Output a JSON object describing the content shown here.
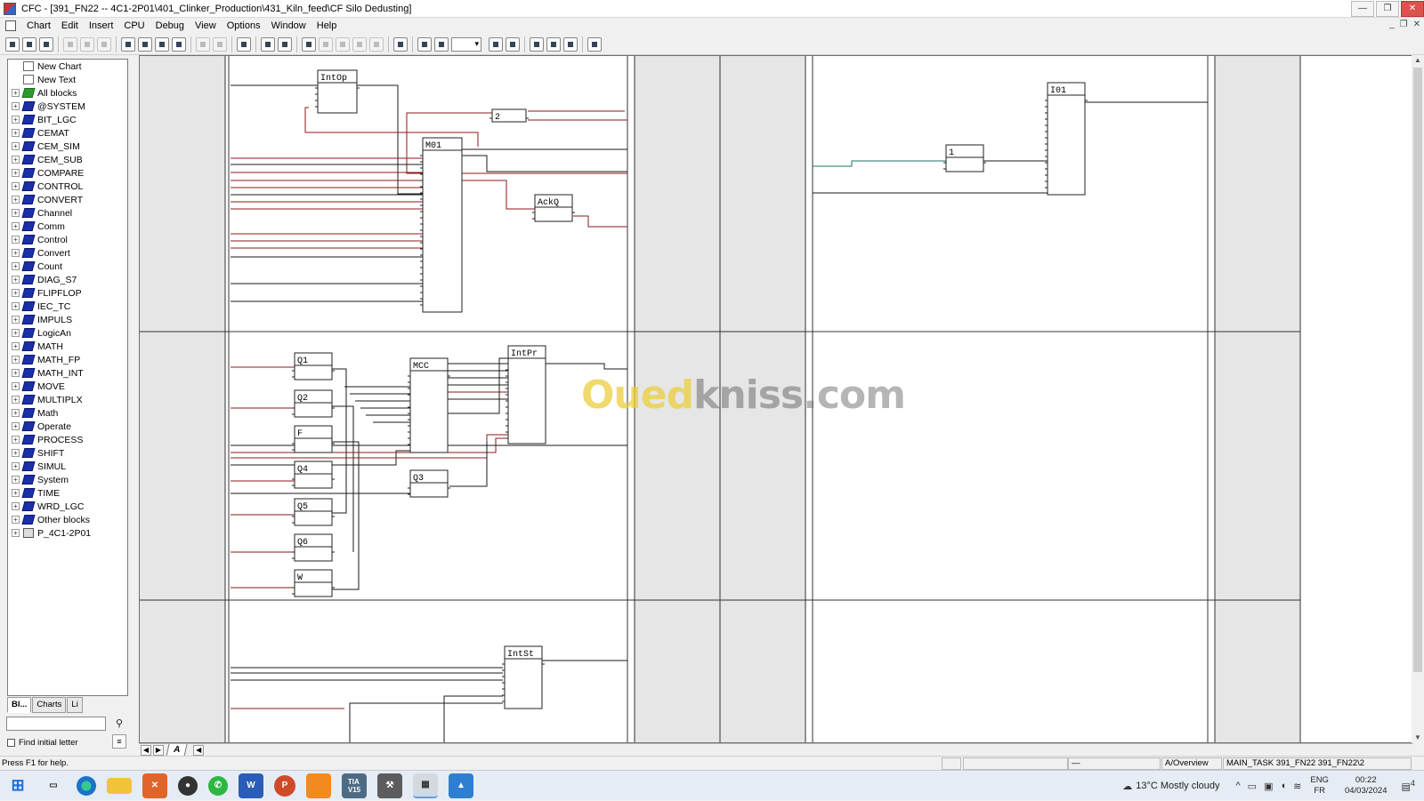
{
  "window": {
    "title": "CFC - [391_FN22 -- 4C1-2P01\\401_Clinker_Production\\431_Kiln_feed\\CF Silo Dedusting]",
    "controls": [
      "—",
      "❐",
      "✕"
    ]
  },
  "menu": [
    "Chart",
    "Edit",
    "Insert",
    "CPU",
    "Debug",
    "View",
    "Options",
    "Window",
    "Help"
  ],
  "mdi_controls": [
    "_",
    "❐",
    "✕"
  ],
  "toolbar_icons": [
    "new-icon",
    "open-icon",
    "print-icon",
    "cut-icon",
    "copy-icon",
    "paste-icon",
    "catalog-icon",
    "overview-icon",
    "tree-icon",
    "interconnect-icon",
    "run-seq-icon",
    "insert-icon",
    "compile-icon",
    "download-icon",
    "test-mode-icon",
    "watch-icon",
    "undo-icon",
    "delete-icon",
    "insert-run-icon",
    "predecessor-icon",
    "fit-icon",
    "grid-icon",
    "sheet-icon",
    "zoom-in-icon",
    "zoom-out-icon",
    "layers-icon",
    "split-h-icon",
    "split-v-icon",
    "help-icon"
  ],
  "tree": [
    {
      "label": "New Chart",
      "icon": "chart-icon",
      "expandable": false
    },
    {
      "label": "New Text",
      "icon": "text-icon",
      "expandable": false
    },
    {
      "label": "All blocks",
      "icon": "all-blocks-icon",
      "expandable": true
    },
    {
      "label": "@SYSTEM",
      "icon": "library-icon",
      "expandable": true
    },
    {
      "label": "BIT_LGC",
      "icon": "library-icon",
      "expandable": true
    },
    {
      "label": "CEMAT",
      "icon": "library-icon",
      "expandable": true
    },
    {
      "label": "CEM_SIM",
      "icon": "library-icon",
      "expandable": true
    },
    {
      "label": "CEM_SUB",
      "icon": "library-icon",
      "expandable": true
    },
    {
      "label": "COMPARE",
      "icon": "library-icon",
      "expandable": true
    },
    {
      "label": "CONTROL",
      "icon": "library-icon",
      "expandable": true
    },
    {
      "label": "CONVERT",
      "icon": "library-icon",
      "expandable": true
    },
    {
      "label": "Channel",
      "icon": "library-icon",
      "expandable": true
    },
    {
      "label": "Comm",
      "icon": "library-icon",
      "expandable": true
    },
    {
      "label": "Control",
      "icon": "library-icon",
      "expandable": true
    },
    {
      "label": "Convert",
      "icon": "library-icon",
      "expandable": true
    },
    {
      "label": "Count",
      "icon": "library-icon",
      "expandable": true
    },
    {
      "label": "DIAG_S7",
      "icon": "library-icon",
      "expandable": true
    },
    {
      "label": "FLIPFLOP",
      "icon": "library-icon",
      "expandable": true
    },
    {
      "label": "IEC_TC",
      "icon": "library-icon",
      "expandable": true
    },
    {
      "label": "IMPULS",
      "icon": "library-icon",
      "expandable": true
    },
    {
      "label": "LogicAn",
      "icon": "library-icon",
      "expandable": true
    },
    {
      "label": "MATH",
      "icon": "library-icon",
      "expandable": true
    },
    {
      "label": "MATH_FP",
      "icon": "library-icon",
      "expandable": true
    },
    {
      "label": "MATH_INT",
      "icon": "library-icon",
      "expandable": true
    },
    {
      "label": "MOVE",
      "icon": "library-icon",
      "expandable": true
    },
    {
      "label": "MULTIPLX",
      "icon": "library-icon",
      "expandable": true
    },
    {
      "label": "Math",
      "icon": "library-icon",
      "expandable": true
    },
    {
      "label": "Operate",
      "icon": "library-icon",
      "expandable": true
    },
    {
      "label": "PROCESS",
      "icon": "library-icon",
      "expandable": true
    },
    {
      "label": "SHIFT",
      "icon": "library-icon",
      "expandable": true
    },
    {
      "label": "SIMUL",
      "icon": "library-icon",
      "expandable": true
    },
    {
      "label": "System",
      "icon": "library-icon",
      "expandable": true
    },
    {
      "label": "TIME",
      "icon": "library-icon",
      "expandable": true
    },
    {
      "label": "WRD_LGC",
      "icon": "library-icon",
      "expandable": true
    },
    {
      "label": "Other blocks",
      "icon": "library-icon",
      "expandable": true
    },
    {
      "label": "P_4C1-2P01",
      "icon": "cpu-icon",
      "expandable": true
    }
  ],
  "left_tabs": [
    {
      "label": "Bl...",
      "active": true
    },
    {
      "label": "Charts",
      "active": false
    },
    {
      "label": "Li",
      "active": false
    }
  ],
  "search": {
    "value": "",
    "placeholder": ""
  },
  "find_initial_letter": {
    "label": "Find initial letter",
    "checked": false
  },
  "chart": {
    "blocks": [
      "IntOp",
      "2",
      "M01",
      "AckQ",
      "I01",
      "1",
      "Q1",
      "Q2",
      "F",
      "Q4",
      "Q5",
      "Q6",
      "W",
      "MCC",
      "IntPr",
      "Q3",
      "IntSt"
    ]
  },
  "watermark": {
    "part1": "Oued",
    "part2": "kniss",
    "part3": ".com"
  },
  "sheet_tab": "A",
  "status": {
    "help": "Press F1 for help.",
    "cell_dash": "—",
    "view": "A/Overview",
    "task": "MAIN_TASK  391_FN22  391_FN22\\2"
  },
  "taskbar": {
    "apps": [
      "start-icon",
      "task-view-icon",
      "edge-icon",
      "explorer-icon",
      "app-icon",
      "chrome-like-icon",
      "whatsapp-icon",
      "word-icon",
      "powerpoint-icon",
      "sublime-icon",
      "tia-portal-icon",
      "tools-icon",
      "simatic-cfc-icon",
      "paint-icon"
    ],
    "tia_label": "TIA\nV15",
    "word_label": "W",
    "ppt_label": "P",
    "weather_temp": "13°C",
    "weather_desc": "Mostly cloudy",
    "lang_top": "ENG",
    "lang_bottom": "FR",
    "time": "00:22",
    "date": "04/03/2024",
    "notifications": "4"
  },
  "colors": {
    "wire_black": "#1a1a1a",
    "wire_red": "#8b1a1a",
    "wire_teal": "#1e6f6f",
    "gray_column": "#e6e6e6",
    "accent_taskbar": "#5aa0e8"
  }
}
